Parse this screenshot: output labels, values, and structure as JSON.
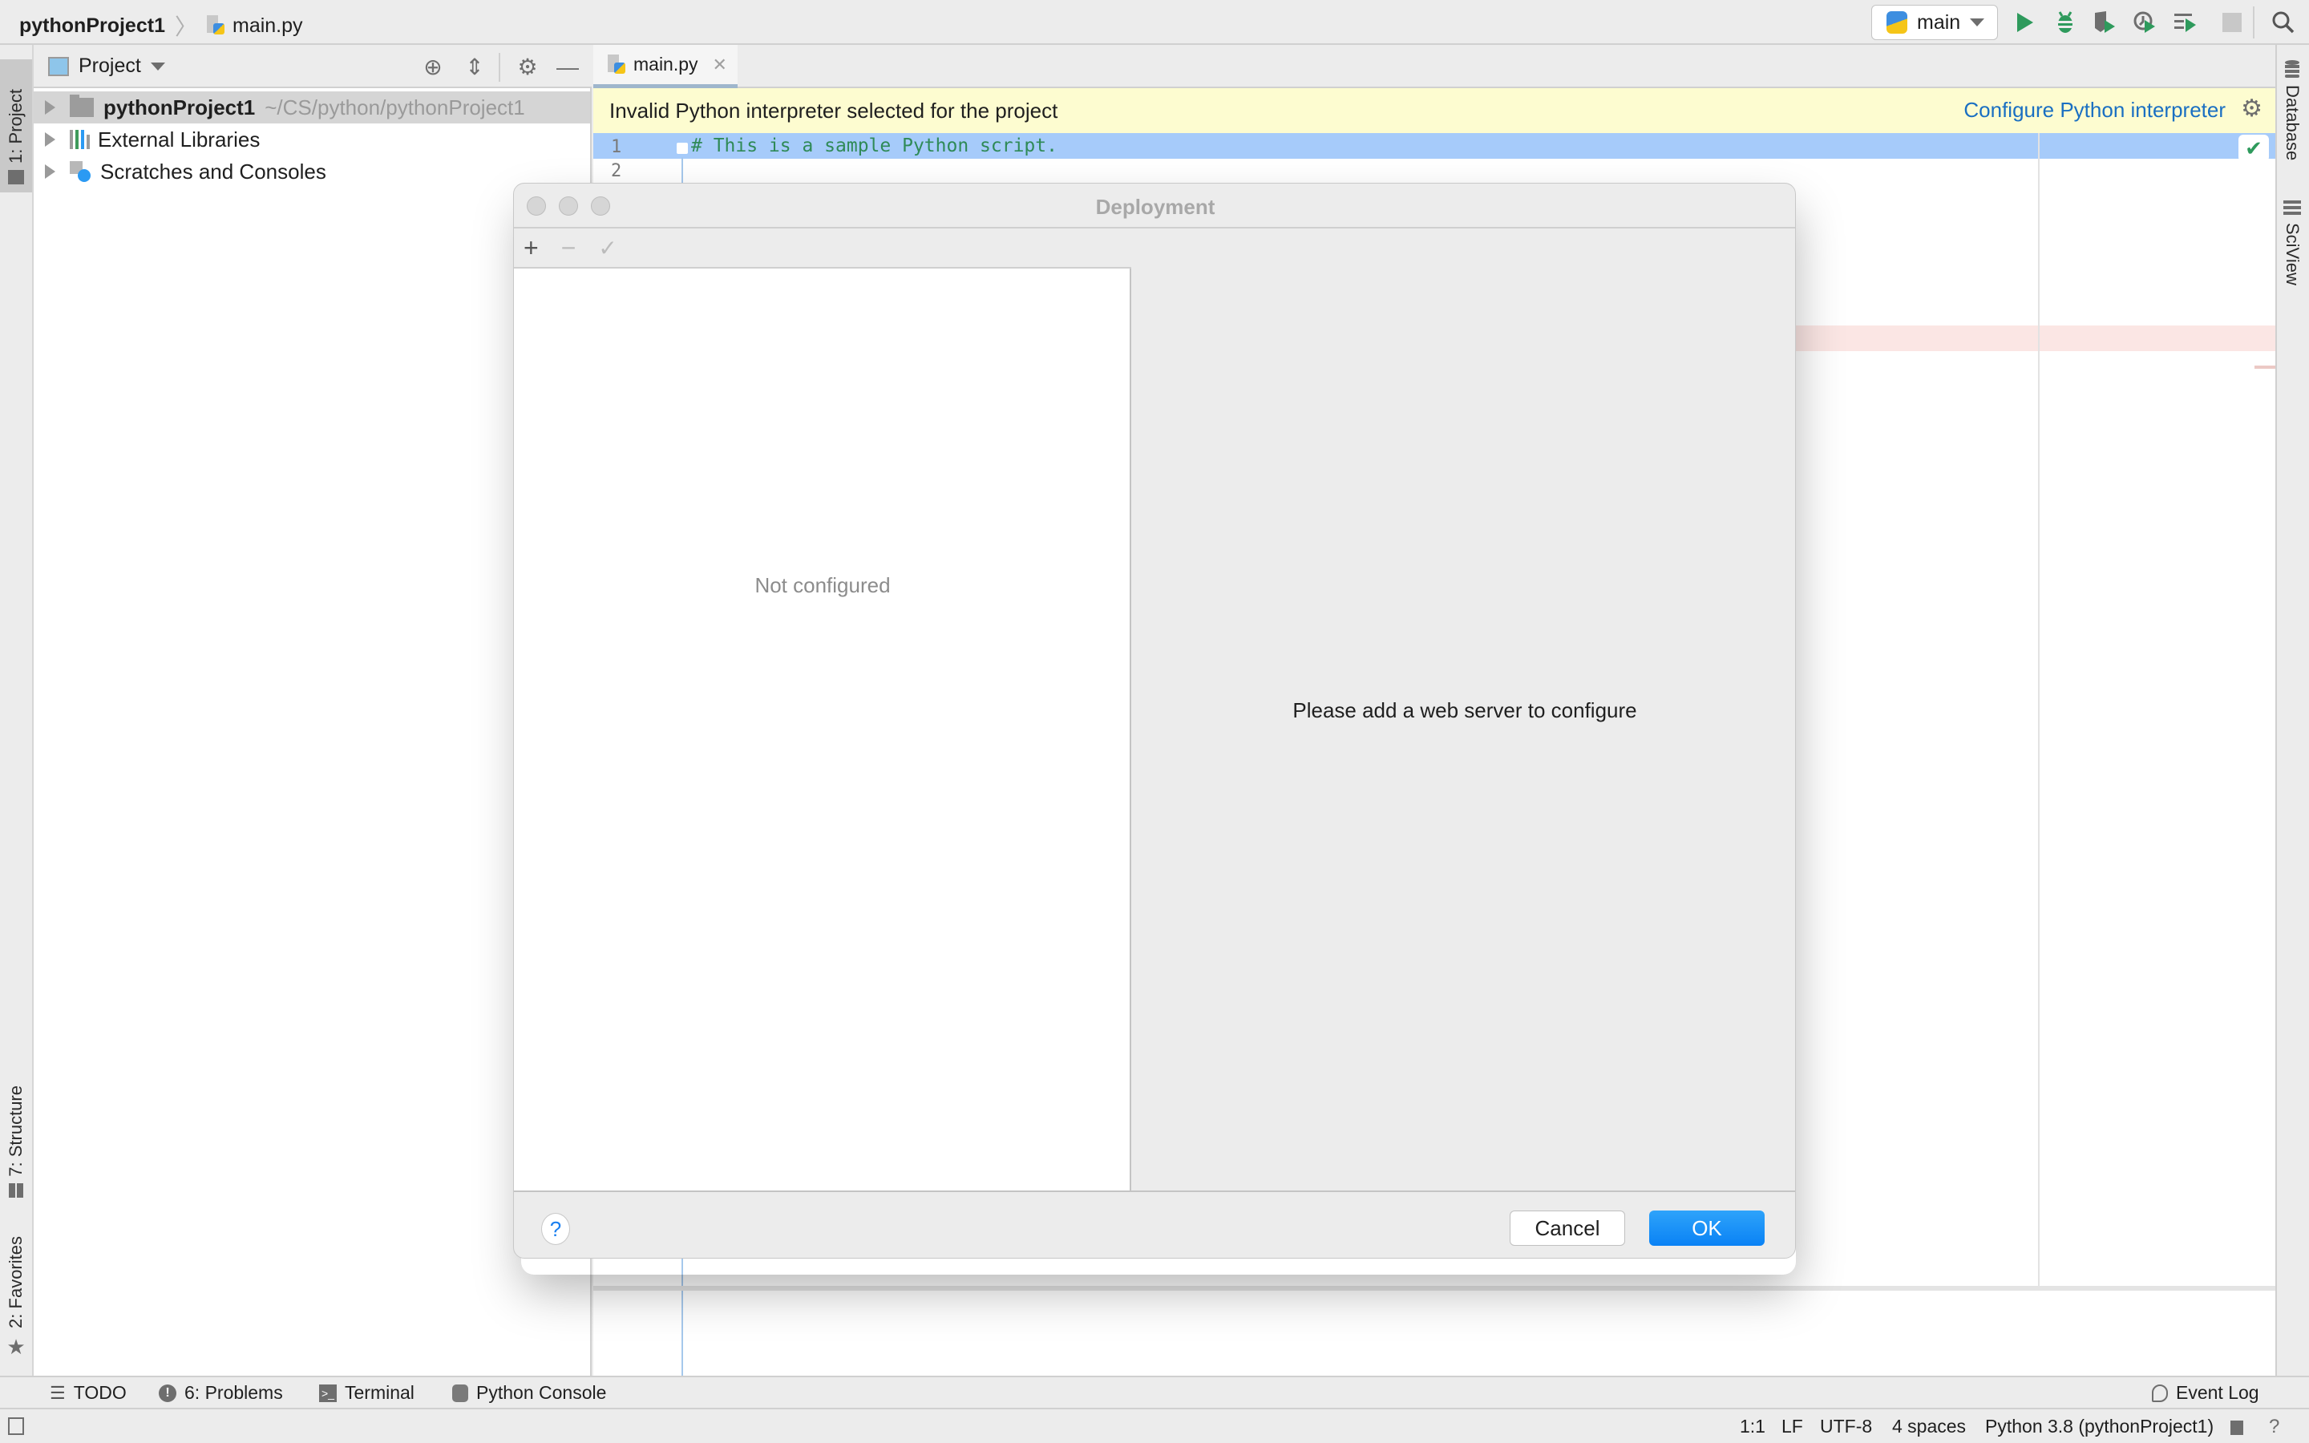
{
  "topbar": {
    "breadcrumb": {
      "project": "pythonProject1",
      "separator": "〉",
      "file": "main.py"
    },
    "run_config": {
      "label": "main"
    },
    "actions": [
      {
        "name": "run",
        "icon": "play-icon"
      },
      {
        "name": "debug",
        "icon": "bug-icon"
      },
      {
        "name": "coverage",
        "icon": "shield-run-icon"
      },
      {
        "name": "profile",
        "icon": "clock-run-icon"
      },
      {
        "name": "concurrency",
        "icon": "list-run-icon"
      },
      {
        "name": "stop",
        "icon": "stop-icon"
      },
      {
        "name": "search",
        "icon": "search-icon"
      }
    ]
  },
  "left_stripe": {
    "project_tab": "1: Project",
    "structure_tab": "7: Structure",
    "favorites_tab": "2: Favorites"
  },
  "right_stripe": {
    "database_tab": "Database",
    "sciview_tab": "SciView"
  },
  "project_panel": {
    "title": "Project",
    "tree": [
      {
        "label": "pythonProject1",
        "path": "~/CS/python/pythonProject1",
        "selected": true,
        "icon": "folder-icon"
      },
      {
        "label": "External Libraries",
        "icon": "library-icon"
      },
      {
        "label": "Scratches and Consoles",
        "icon": "scratch-icon"
      }
    ]
  },
  "editor": {
    "tab_label": "main.py",
    "banner_message": "Invalid Python interpreter selected for the project",
    "banner_link": "Configure Python interpreter",
    "lines": [
      {
        "number": "1",
        "text": "# This is a sample Python script."
      },
      {
        "number": "2",
        "text": ""
      }
    ]
  },
  "dialog": {
    "title": "Deployment",
    "toolbar": {
      "add": "+",
      "remove": "−",
      "apply": "✓"
    },
    "list_empty_text": "Not configured",
    "detail_empty_text": "Please add a web server to configure",
    "help_label": "?",
    "cancel_label": "Cancel",
    "ok_label": "OK"
  },
  "bottom_tools": [
    {
      "label": "TODO",
      "icon": "list-icon"
    },
    {
      "label": "6: Problems",
      "icon": "warning-icon"
    },
    {
      "label": "Terminal",
      "icon": "terminal-icon"
    },
    {
      "label": "Python Console",
      "icon": "python-icon"
    }
  ],
  "event_log": "Event Log",
  "statusbar": {
    "position": "1:1",
    "line_separator": "LF",
    "encoding": "UTF-8",
    "indent": "4 spaces",
    "interpreter": "Python 3.8 (pythonProject1)"
  },
  "colors": {
    "accent": "#0a82f5",
    "run_green": "#2e9a5c",
    "link": "#1a6fc2",
    "banner_bg": "#fdfcd0",
    "selection": "#a6cbfa",
    "comment": "#2f8a57"
  }
}
